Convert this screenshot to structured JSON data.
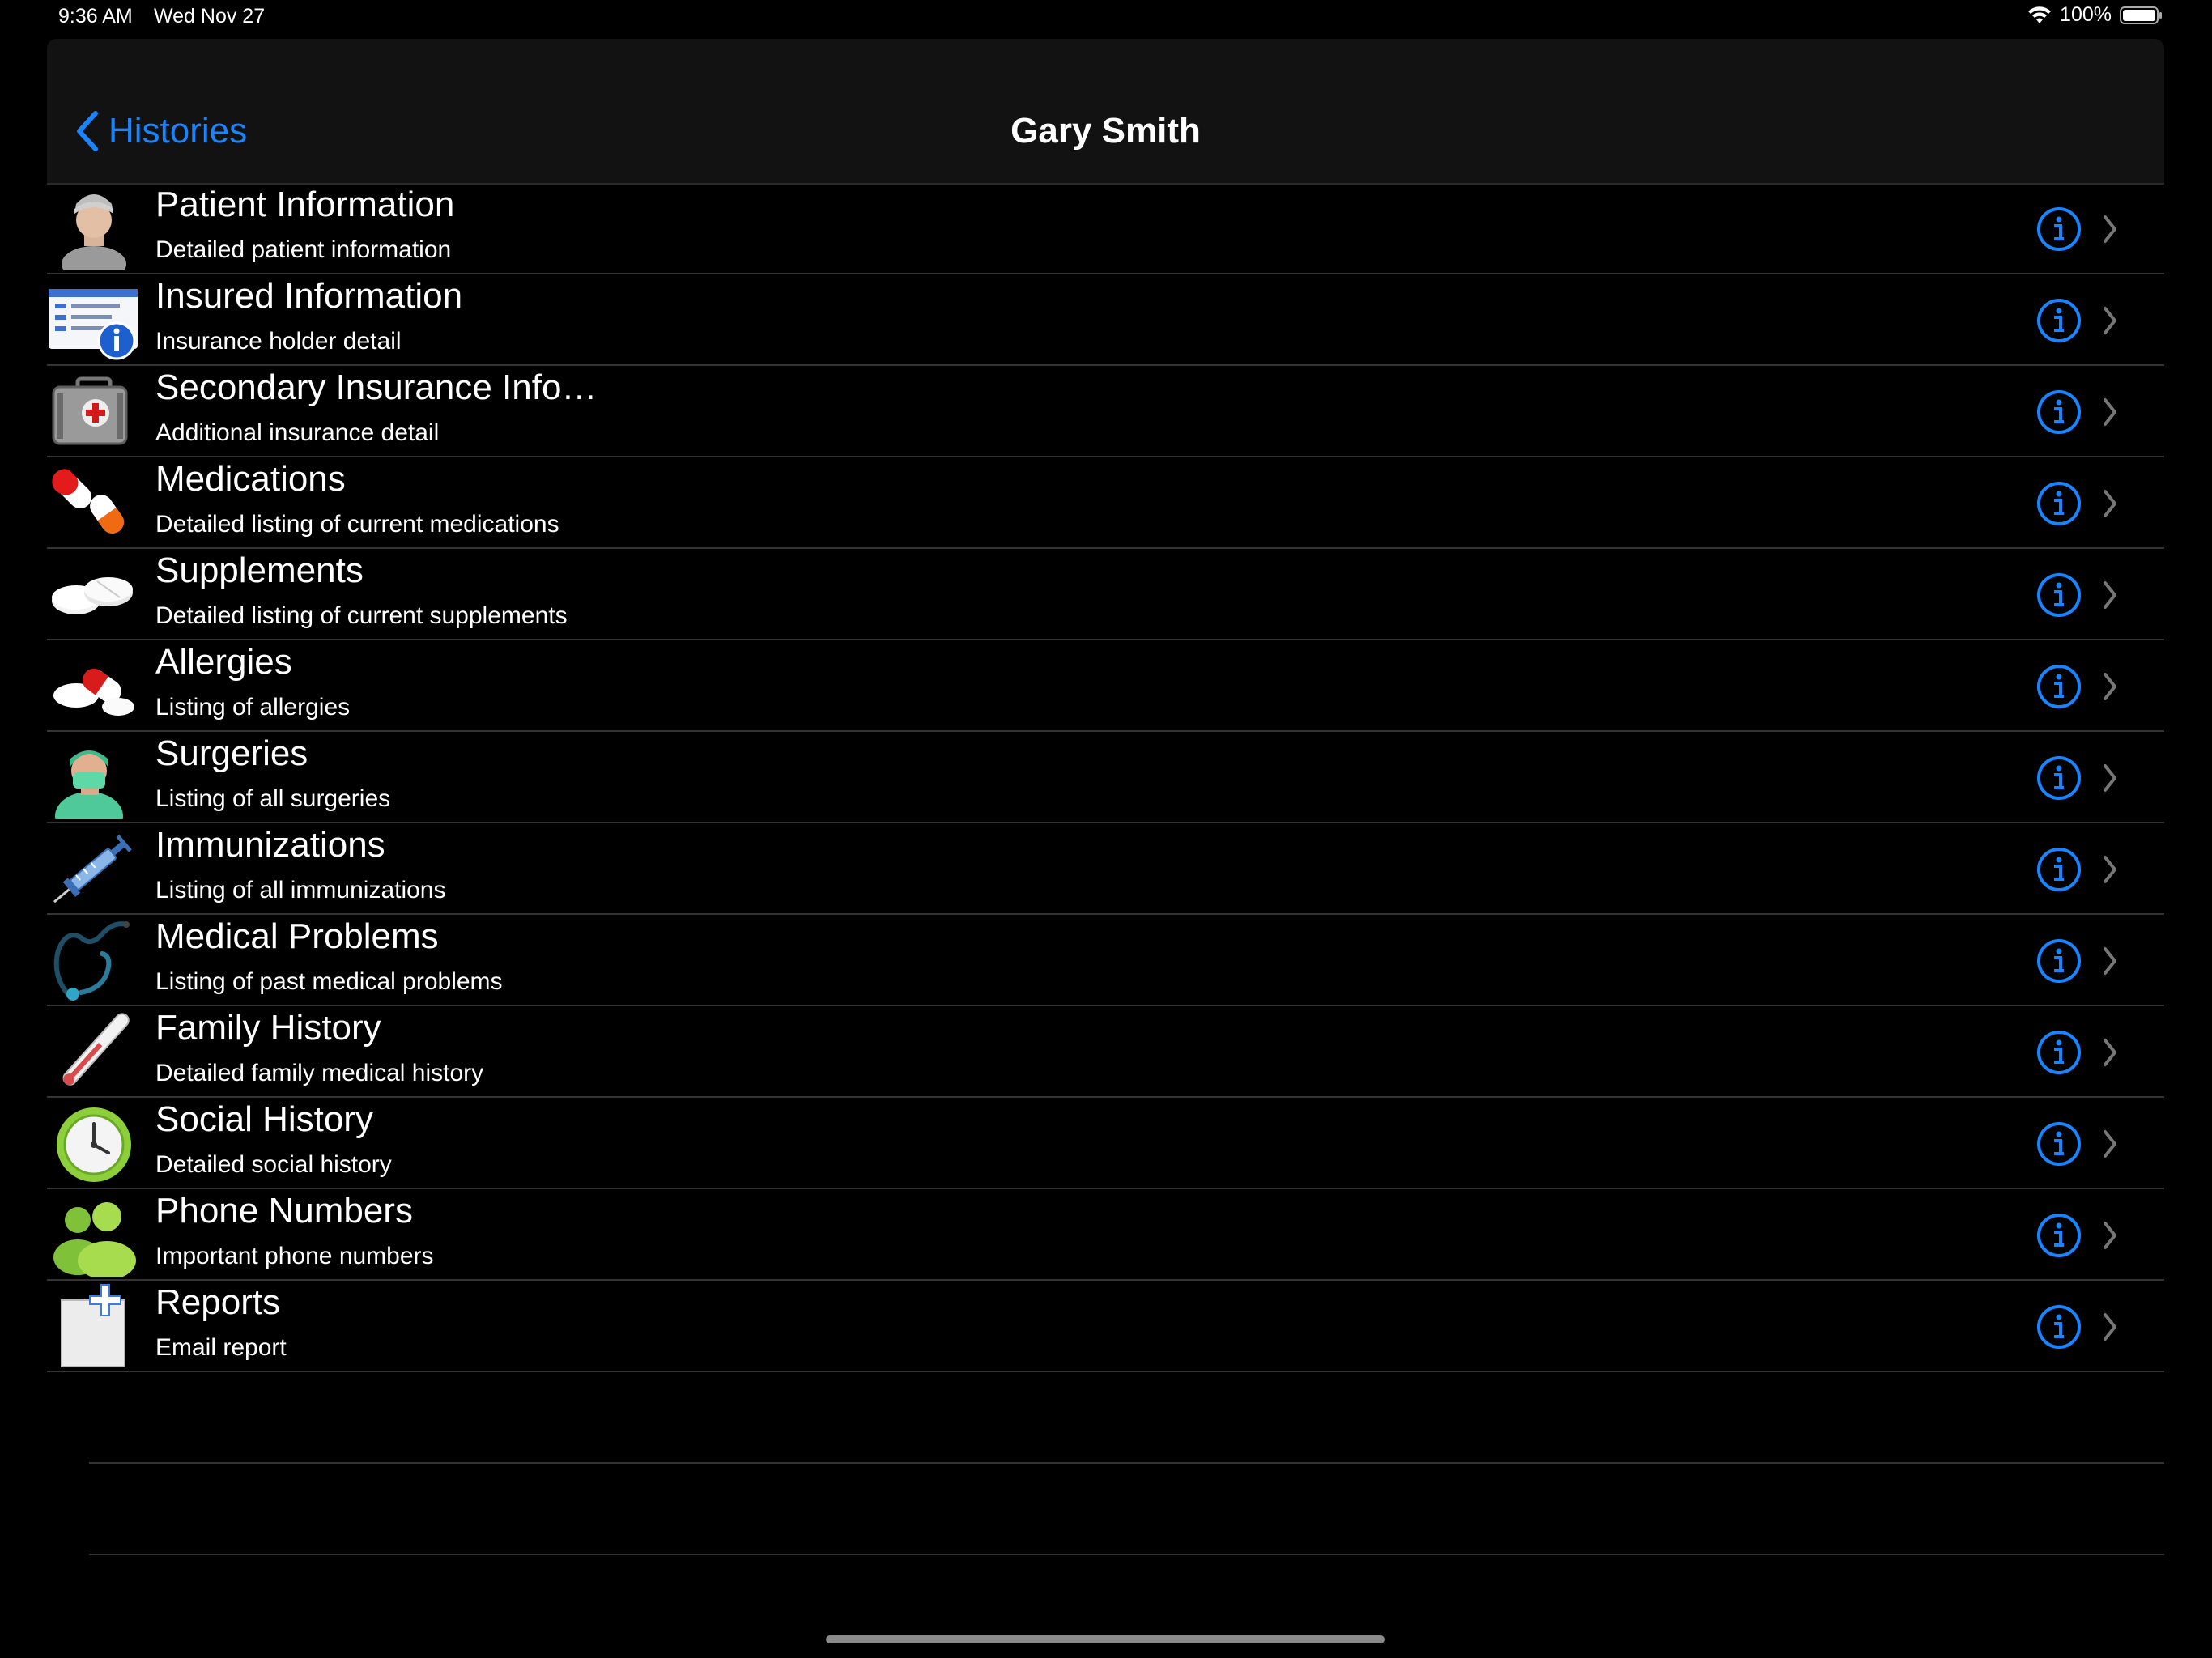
{
  "status_bar": {
    "time": "9:36 AM",
    "date": "Wed Nov 27",
    "battery": "100%"
  },
  "nav": {
    "back_label": "Histories",
    "title": "Gary Smith"
  },
  "colors": {
    "accent": "#1a84ff",
    "background": "#000000",
    "nav_background": "#121212"
  },
  "rows": [
    {
      "title": "Patient Information",
      "subtitle": "Detailed patient information",
      "icon": "patient-icon"
    },
    {
      "title": "Insured Information",
      "subtitle": "Insurance holder detail",
      "icon": "insurance-card-icon"
    },
    {
      "title": "Secondary Insurance Info…",
      "subtitle": "Additional insurance detail",
      "icon": "medical-kit-icon"
    },
    {
      "title": "Medications",
      "subtitle": "Detailed listing of current medications",
      "icon": "capsules-icon"
    },
    {
      "title": "Supplements",
      "subtitle": "Detailed listing of current supplements",
      "icon": "tablets-icon"
    },
    {
      "title": "Allergies",
      "subtitle": "Listing of allergies",
      "icon": "allergy-pills-icon"
    },
    {
      "title": "Surgeries",
      "subtitle": "Listing of all surgeries",
      "icon": "surgeon-icon"
    },
    {
      "title": "Immunizations",
      "subtitle": "Listing of all immunizations",
      "icon": "syringe-icon"
    },
    {
      "title": "Medical Problems",
      "subtitle": "Listing of past medical problems",
      "icon": "stethoscope-icon"
    },
    {
      "title": "Family History",
      "subtitle": "Detailed family medical history",
      "icon": "thermometer-icon"
    },
    {
      "title": "Social History",
      "subtitle": "Detailed social history",
      "icon": "clock-icon"
    },
    {
      "title": "Phone Numbers",
      "subtitle": "Important phone numbers",
      "icon": "people-icon"
    },
    {
      "title": "Reports",
      "subtitle": "Email report",
      "icon": "new-report-icon"
    }
  ]
}
